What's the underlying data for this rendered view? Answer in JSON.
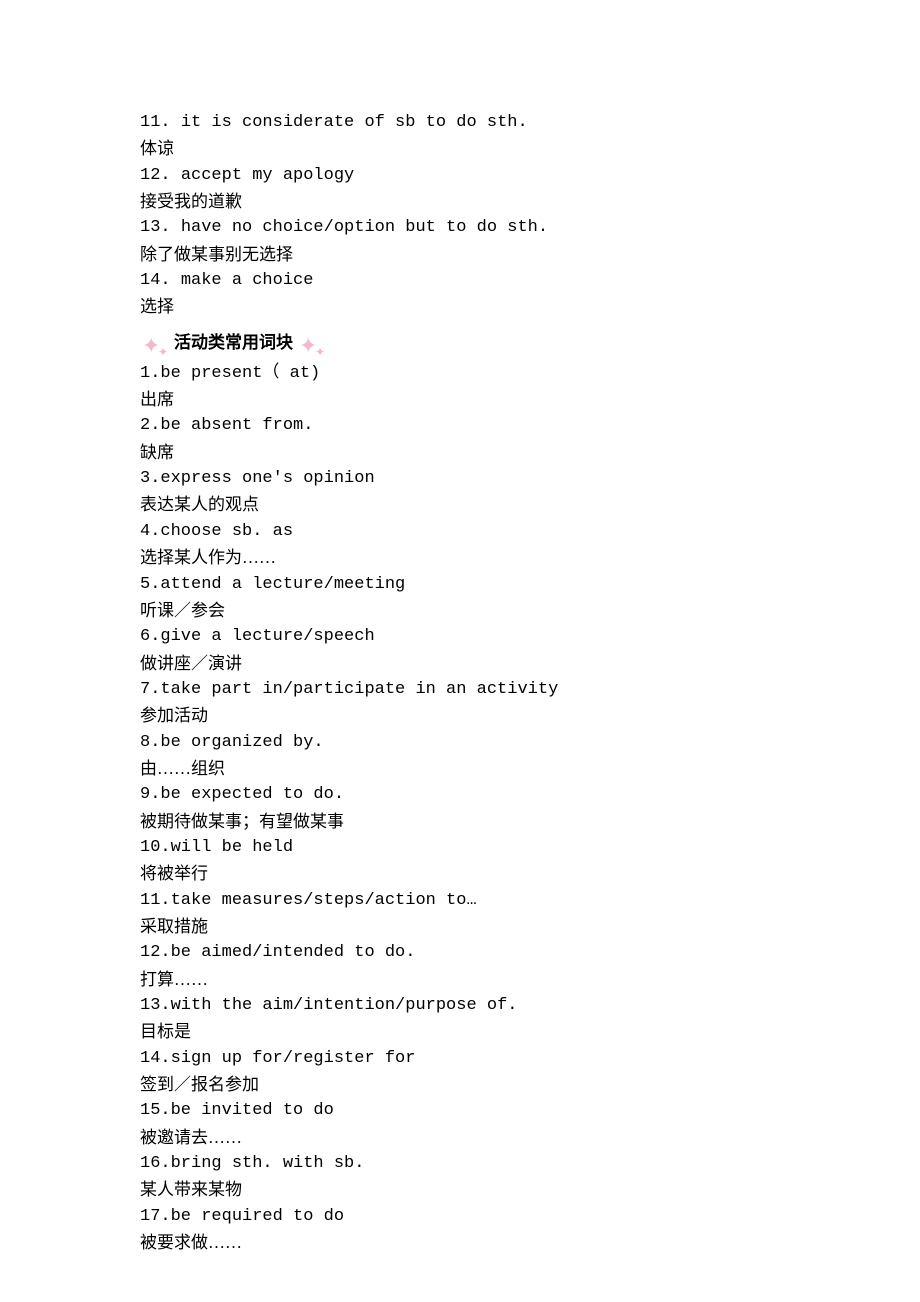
{
  "top_items": [
    {
      "num": "11. ",
      "en": "it is considerate of sb to do sth.",
      "zh": "体谅"
    },
    {
      "num": "12. ",
      "en": "accept my apology",
      "zh": "接受我的道歉"
    },
    {
      "num": "13. ",
      "en": "have no choice/option but to do sth.",
      "zh": "除了做某事别无选择"
    },
    {
      "num": "14. ",
      "en": "make a choice",
      "zh": "选择"
    }
  ],
  "section_title": "活动类常用词块",
  "items": [
    {
      "num": "1.",
      "en": "be present（ at)",
      "zh": "出席"
    },
    {
      "num": "2.",
      "en": "be absent from.",
      "zh": "缺席"
    },
    {
      "num": "3.",
      "en": "express one's opinion",
      "zh": "表达某人的观点"
    },
    {
      "num": "4.",
      "en": "choose sb. as",
      "zh": "选择某人作为……"
    },
    {
      "num": "5.",
      "en": "attend a lecture/meeting",
      "zh": "听课／参会"
    },
    {
      "num": "6.",
      "en": "give a lecture/speech",
      "zh": "做讲座／演讲"
    },
    {
      "num": "7.",
      "en": "take part in/participate in an activity",
      "zh": "参加活动"
    },
    {
      "num": "8.",
      "en": "be organized by.",
      "zh": "由……组织"
    },
    {
      "num": "9.",
      "en": "be expected to do.",
      "zh": "被期待做某事；有望做某事"
    },
    {
      "num": "10.",
      "en": "will be held",
      "zh": "将被举行"
    },
    {
      "num": "11.",
      "en": "take measures/steps/action to…",
      "zh": "采取措施"
    },
    {
      "num": "12.",
      "en": "be aimed/intended to do.",
      "zh": "打算……"
    },
    {
      "num": "13.",
      "en": "with the aim/intention/purpose of.",
      "zh": "目标是"
    },
    {
      "num": "14.",
      "en": "sign up for/register for",
      "zh": "签到／报名参加"
    },
    {
      "num": "15.",
      "en": "be invited to do",
      "zh": "被邀请去……"
    },
    {
      "num": "16.",
      "en": "bring sth. with sb.",
      "zh": "某人带来某物"
    },
    {
      "num": "17.",
      "en": "be required to do",
      "zh": "被要求做……"
    }
  ]
}
